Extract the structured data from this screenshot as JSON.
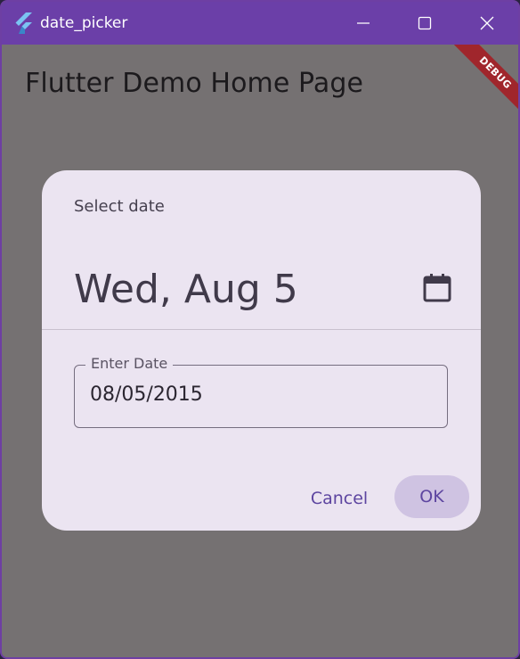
{
  "window": {
    "title": "date_picker",
    "accent_color": "#6b3fa8"
  },
  "app_bar": {
    "title": "Flutter Demo Home Page"
  },
  "debug_banner": {
    "label": "DEBUG"
  },
  "dialog": {
    "header_label": "Select date",
    "selected_date_headline": "Wed, Aug 5",
    "mode_toggle_icon": "calendar-icon",
    "date_field": {
      "label": "Enter Date",
      "value": "08/05/2015"
    },
    "actions": {
      "cancel_label": "Cancel",
      "ok_label": "OK"
    }
  }
}
